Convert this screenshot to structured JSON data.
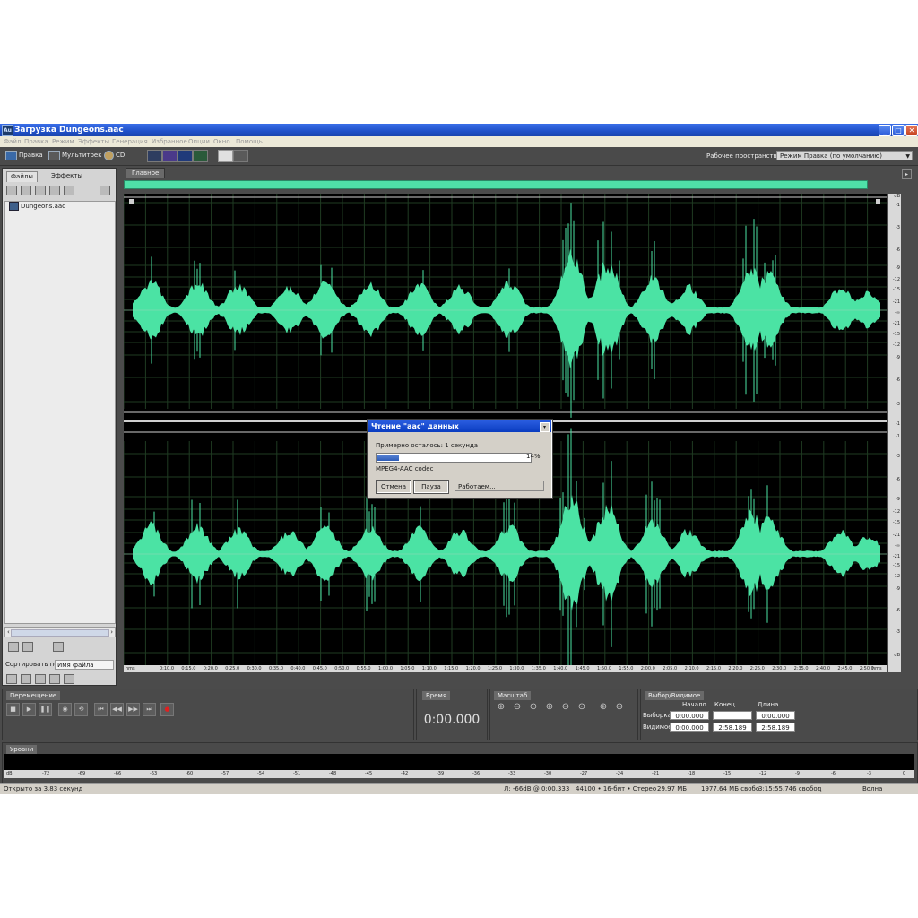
{
  "window": {
    "app_icon": "Au",
    "title": "Загрузка Dungeons.aac",
    "buttons": {
      "minimize": "_",
      "maximize": "□",
      "close": "✕"
    }
  },
  "menu": [
    "Файл",
    "Правка",
    "Режим",
    "Эффекты",
    "Генерация",
    "Избранное",
    "Опции",
    "Окно",
    "Помощь"
  ],
  "toolbar": {
    "edit_label": "Правка",
    "multitrack_label": "Мультитрек",
    "cd_label": "CD",
    "workspace_label": "Рабочее пространство:",
    "workspace_value": "Режим Правка (по умолчанию)"
  },
  "left_panel": {
    "tabs": [
      "Файлы",
      "Эффекты"
    ],
    "files": [
      "Dungeons.aac"
    ],
    "sort_label": "Сортировать по:",
    "sort_value": "Имя файла"
  },
  "editor": {
    "tab": "Главное",
    "db_ticks": [
      "dB",
      "-1",
      "-3",
      "-6",
      "-9",
      "-12",
      "-15",
      "-21",
      "-∞",
      "-21",
      "-15",
      "-12",
      "-9",
      "-6",
      "-3",
      "-1"
    ],
    "db_ticks_lower": [
      "-1",
      "-3",
      "-6",
      "-9",
      "-12",
      "-15",
      "-21",
      "-∞",
      "-21",
      "-15",
      "-12",
      "-9",
      "-6",
      "-3",
      "dB"
    ],
    "time_ticks": [
      "hms",
      "0:10.0",
      "0:15.0",
      "0:20.0",
      "0:25.0",
      "0:30.0",
      "0:35.0",
      "0:40.0",
      "0:45.0",
      "0:50.0",
      "0:55.0",
      "1:00.0",
      "1:05.0",
      "1:10.0",
      "1:15.0",
      "1:20.0",
      "1:25.0",
      "1:30.0",
      "1:35.0",
      "1:40.0",
      "1:45.0",
      "1:50.0",
      "1:55.0",
      "2:00.0",
      "2:05.0",
      "2:10.0",
      "2:15.0",
      "2:20.0",
      "2:25.0",
      "2:30.0",
      "2:35.0",
      "2:40.0",
      "2:45.0",
      "2:50.0",
      "hms"
    ],
    "waveform_color": "#4be3a4"
  },
  "transport": {
    "tab": "Перемещение"
  },
  "time_panel": {
    "tab": "Время",
    "value": "0:00.000"
  },
  "zoom_panel": {
    "tab": "Масштаб"
  },
  "selection_panel": {
    "tab": "Выбор/Видимое",
    "headers": [
      "Начало",
      "Конец",
      "Длина"
    ],
    "rows": [
      {
        "label": "Выборка",
        "start": "0:00.000",
        "end": "",
        "length": "0:00.000"
      },
      {
        "label": "Видимое",
        "start": "0:00.000",
        "end": "2:58.189",
        "length": "2:58.189"
      }
    ]
  },
  "levels": {
    "tab": "Уровни",
    "ticks": [
      "dB",
      "-72",
      "-69",
      "-66",
      "-63",
      "-60",
      "-57",
      "-54",
      "-51",
      "-48",
      "-45",
      "-42",
      "-39",
      "-36",
      "-33",
      "-30",
      "-27",
      "-24",
      "-21",
      "-18",
      "-15",
      "-12",
      "-9",
      "-6",
      "-3",
      "0"
    ]
  },
  "status_bar": {
    "opened": "Открыто за 3.83 секунд",
    "level": "Л: -66dB @  0:00.333",
    "format": "44100 • 16-бит • Стерео",
    "size": "29.97 МБ",
    "free": "1977.64 МБ свобо",
    "free_time": "3:15:55.746 свобод",
    "mode": "Волна"
  },
  "dialog": {
    "title": "Чтение \"aac\" данных",
    "remaining": "Примерно осталось: 1 секунда",
    "progress_fraction": 0.14,
    "percent": "14%",
    "codec": "MPEG4-AAC codec",
    "cancel": "Отмена",
    "pause": "Пауза",
    "status": "Работаем..."
  }
}
